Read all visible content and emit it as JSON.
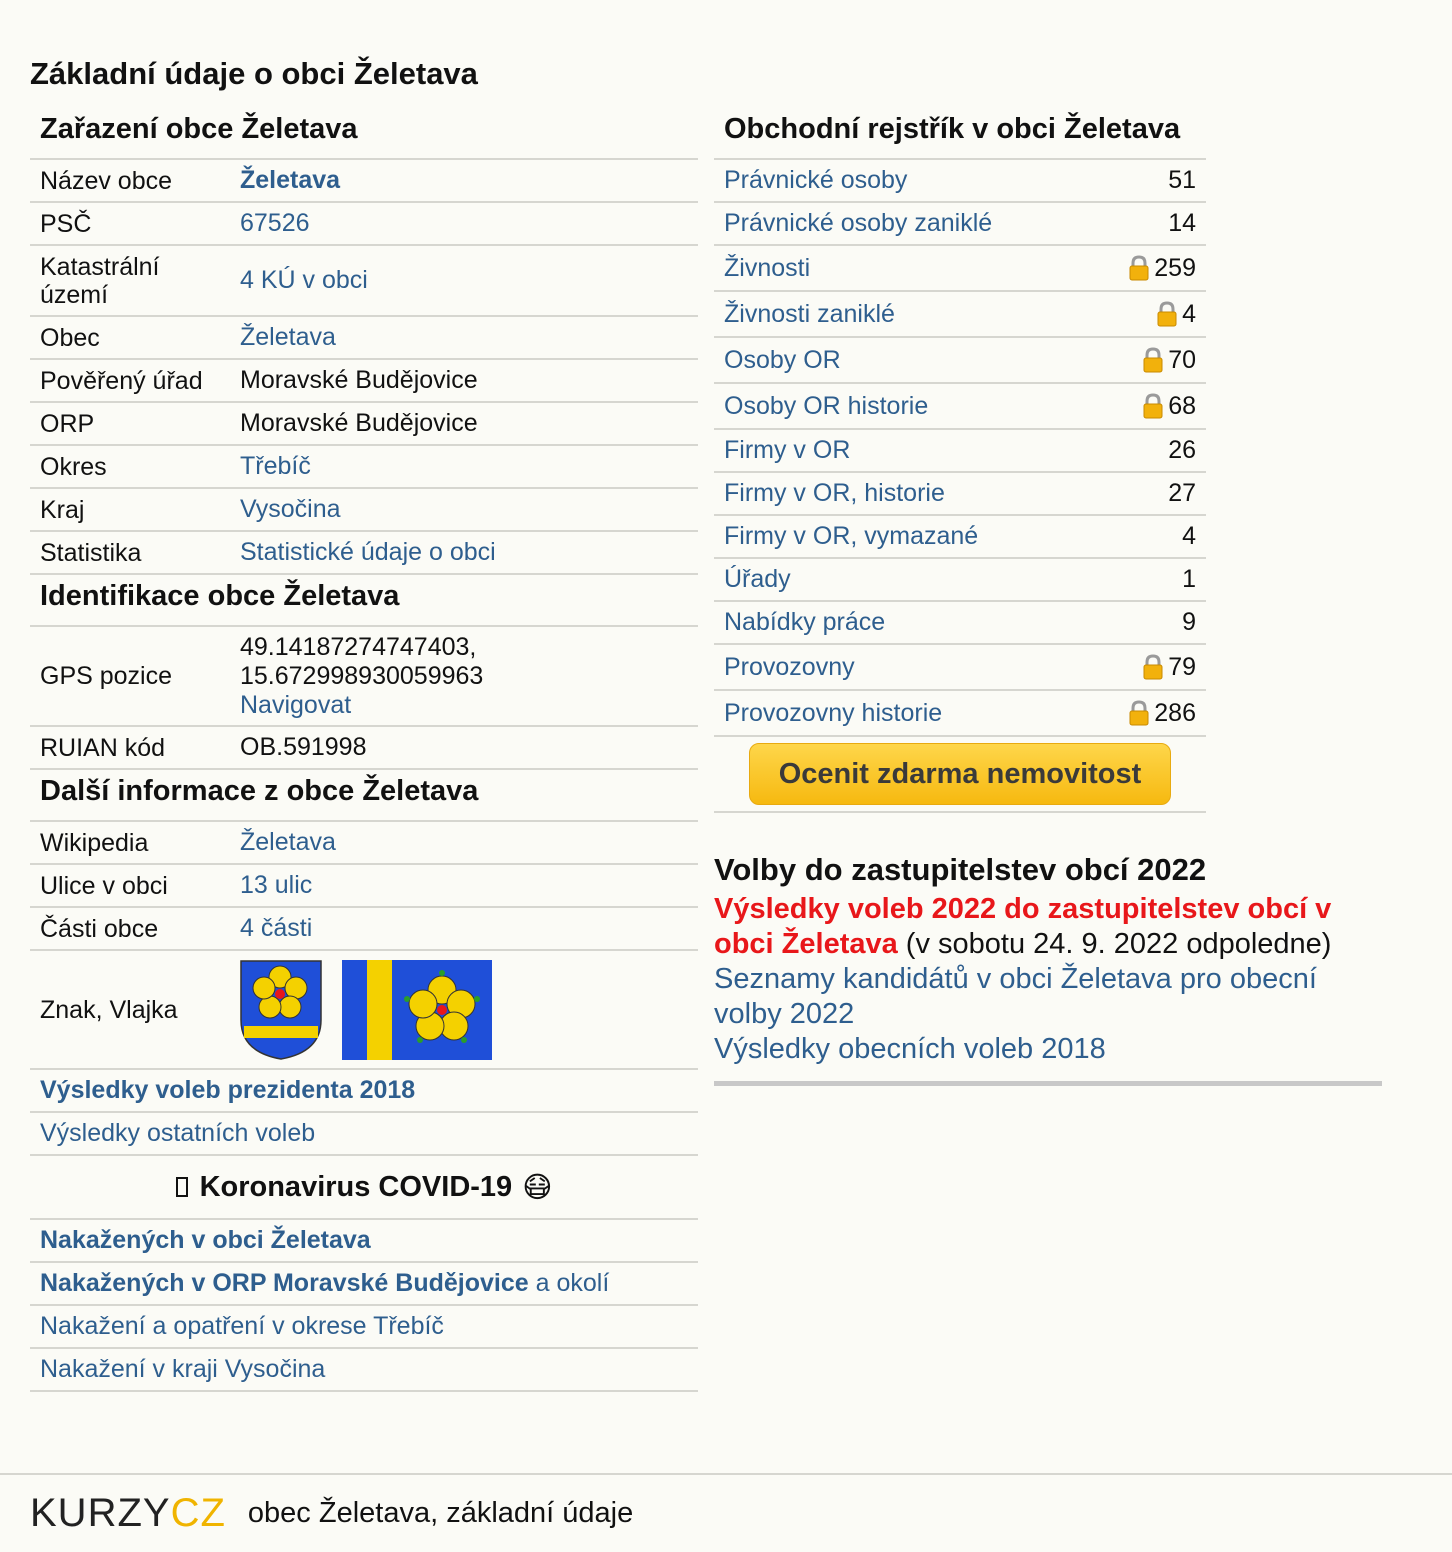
{
  "page_title": "Základní údaje o obci Želetava",
  "zarazeni": {
    "heading": "Zařazení obce Želetava",
    "rows": [
      {
        "label": "Název obce",
        "value": "Želetava"
      },
      {
        "label": "PSČ",
        "value": "67526"
      },
      {
        "label": "Katastrální území",
        "value": "4 KÚ v obci"
      },
      {
        "label": "Obec",
        "value": "Želetava"
      },
      {
        "label": "Pověřený úřad",
        "value": "Moravské Budějovice"
      },
      {
        "label": "ORP",
        "value": "Moravské Budějovice"
      },
      {
        "label": "Okres",
        "value": "Třebíč"
      },
      {
        "label": "Kraj",
        "value": "Vysočina"
      },
      {
        "label": "Statistika",
        "value": "Statistické údaje o obci"
      }
    ]
  },
  "identifikace": {
    "heading": "Identifikace obce Želetava",
    "gps_label": "GPS pozice",
    "gps_line1": "49.14187274747403,",
    "gps_line2": "15.672998930059963",
    "gps_link": "Navigovat",
    "ruian_label": "RUIAN kód",
    "ruian_value": "OB.591998"
  },
  "dalsi": {
    "heading": "Další informace z obce Želetava",
    "rows": [
      {
        "label": "Wikipedia",
        "value": "Želetava"
      },
      {
        "label": "Ulice v obci",
        "value": "13 ulic"
      },
      {
        "label": "Části obce",
        "value": "4 části"
      }
    ],
    "znak_label": "Znak, Vlajka"
  },
  "volby_links": {
    "prezident": "Výsledky voleb prezidenta 2018",
    "ostatni": "Výsledky ostatních voleb"
  },
  "covid": {
    "heading": "Koronavirus COVID-19",
    "emoji": "😷",
    "obec": "Nakažených v obci Želetava",
    "orp_link": "Nakažených v ORP Moravské Budějovice",
    "orp_suffix": " a okolí",
    "okres": "Nakažení a opatření v okrese Třebíč",
    "kraj": "Nakažení v kraji Vysočina"
  },
  "rejstrik": {
    "heading": "Obchodní rejstřík v obci Želetava",
    "rows": [
      {
        "label": "Právnické osoby",
        "count": "51",
        "locked": false
      },
      {
        "label": "Právnické osoby zaniklé",
        "count": "14",
        "locked": false
      },
      {
        "label": "Živnosti",
        "count": "259",
        "locked": true
      },
      {
        "label": "Živnosti zaniklé",
        "count": "4",
        "locked": true
      },
      {
        "label": "Osoby OR",
        "count": "70",
        "locked": true
      },
      {
        "label": "Osoby OR historie",
        "count": "68",
        "locked": true
      },
      {
        "label": "Firmy v OR",
        "count": "26",
        "locked": false
      },
      {
        "label": "Firmy v OR, historie",
        "count": "27",
        "locked": false
      },
      {
        "label": "Firmy v OR, vymazané",
        "count": "4",
        "locked": false
      },
      {
        "label": "Úřady",
        "count": "1",
        "locked": false
      },
      {
        "label": "Nabídky práce",
        "count": "9",
        "locked": false
      },
      {
        "label": "Provozovny",
        "count": "79",
        "locked": true
      },
      {
        "label": "Provozovny historie",
        "count": "286",
        "locked": true
      }
    ],
    "button": "Ocenit zdarma nemovitost"
  },
  "volby2022": {
    "heading": "Volby do zastupitelstev obcí 2022",
    "red_link": "Výsledky voleb 2022 do zastupitelstev obcí v obci Želetava",
    "note": " (v sobotu 24. 9. 2022 odpoledne)",
    "kandidati": "Seznamy kandidátů v obci Želetava pro obecní volby 2022",
    "vysledky2018": "Výsledky obecních voleb 2018"
  },
  "footer": {
    "logo_a": "KURZY",
    "logo_b": "CZ",
    "text": "obec Želetava, základní údaje"
  },
  "colors": {
    "link": "#2e5e8e",
    "red": "#e8171a",
    "button": "#fcc935",
    "background": "#fbfbf6"
  }
}
